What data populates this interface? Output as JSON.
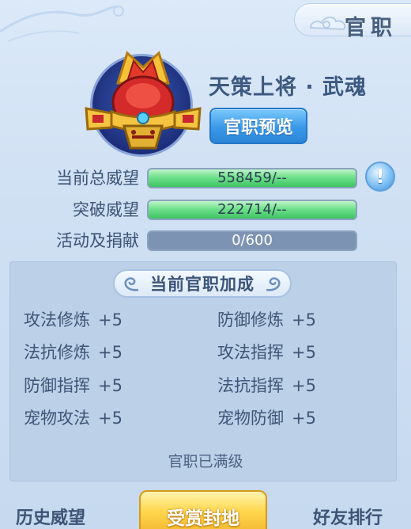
{
  "header": {
    "title": "官职"
  },
  "rank": {
    "name": "天策上将 · 武魂",
    "preview_button": "官职预览"
  },
  "stats": [
    {
      "label": "当前总威望",
      "value": "558459/--",
      "fill": 1.0
    },
    {
      "label": "突破威望",
      "value": "222714/--",
      "fill": 1.0
    },
    {
      "label": "活动及捐献",
      "value": "0/600",
      "fill": 0.0
    }
  ],
  "info_button": "!",
  "bonus": {
    "title": "当前官职加成",
    "items": [
      {
        "name": "攻法修炼",
        "value": "+5"
      },
      {
        "name": "防御修炼",
        "value": "+5"
      },
      {
        "name": "法抗修炼",
        "value": "+5"
      },
      {
        "name": "攻法指挥",
        "value": "+5"
      },
      {
        "name": "防御指挥",
        "value": "+5"
      },
      {
        "name": "法抗指挥",
        "value": "+5"
      },
      {
        "name": "宠物攻法",
        "value": "+5"
      },
      {
        "name": "宠物防御",
        "value": "+5"
      }
    ],
    "status": "官职已满级"
  },
  "bottom_tabs": {
    "history": "历史威望",
    "fief": "受赏封地",
    "friends": "好友排行"
  },
  "colors": {
    "accent_blue": "#3a99e8",
    "bar_green": "#6fe08b",
    "gold": "#ffd84f"
  }
}
